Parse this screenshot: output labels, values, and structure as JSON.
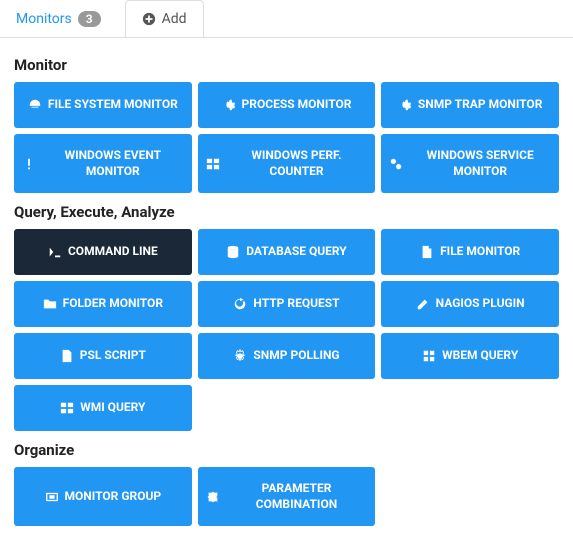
{
  "tabs": {
    "monitors": {
      "label": "Monitors",
      "badge": "3"
    },
    "add": {
      "label": "Add"
    }
  },
  "sections": {
    "monitor": {
      "title": "Monitor",
      "items": [
        {
          "label": "FILE SYSTEM MONITOR"
        },
        {
          "label": "PROCESS MONITOR"
        },
        {
          "label": "SNMP TRAP MONITOR"
        },
        {
          "label": "WINDOWS EVENT MONITOR"
        },
        {
          "label": "WINDOWS PERF. COUNTER"
        },
        {
          "label": "WINDOWS SERVICE MONITOR"
        }
      ]
    },
    "query": {
      "title": "Query, Execute, Analyze",
      "items": [
        {
          "label": "COMMAND LINE"
        },
        {
          "label": "DATABASE QUERY"
        },
        {
          "label": "FILE MONITOR"
        },
        {
          "label": "FOLDER MONITOR"
        },
        {
          "label": "HTTP REQUEST"
        },
        {
          "label": "NAGIOS PLUGIN"
        },
        {
          "label": "PSL SCRIPT"
        },
        {
          "label": "SNMP POLLING"
        },
        {
          "label": "WBEM QUERY"
        },
        {
          "label": "WMI QUERY"
        }
      ]
    },
    "organize": {
      "title": "Organize",
      "items": [
        {
          "label": "MONITOR GROUP"
        },
        {
          "label": "PARAMETER COMBINATION"
        }
      ]
    }
  }
}
